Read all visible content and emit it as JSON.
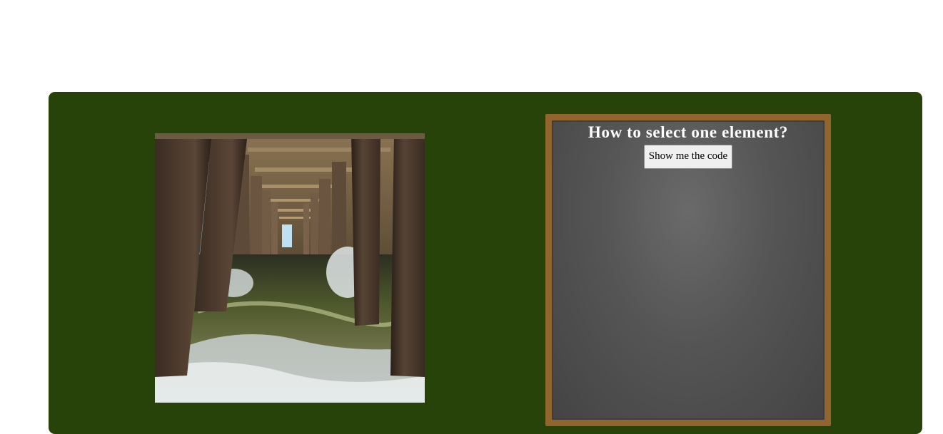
{
  "photo": {
    "subject": "under-pier ocean photograph",
    "alt": ""
  },
  "board": {
    "title": "How to select one element?",
    "button_label": "Show me the code"
  },
  "colors": {
    "stage_background": "#284309",
    "board_frame": "#92652f",
    "board_surface": "#555555",
    "title_text": "#ffffff"
  }
}
